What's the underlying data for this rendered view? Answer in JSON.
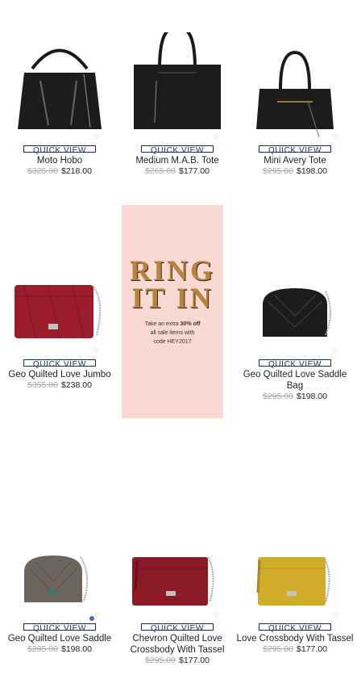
{
  "quick_view_label": "QUICK VIEW",
  "heart_icon": "heart-outline",
  "products": [
    {
      "name": "Moto Hobo",
      "old_price": "$325.00",
      "price": "$218.00"
    },
    {
      "name": "Medium M.A.B. Tote",
      "old_price": "$265.00",
      "price": "$177.00"
    },
    {
      "name": "Mini Avery Tote",
      "old_price": "$295.00",
      "price": "$198.00"
    },
    {
      "name": "Geo Quilted Love Jumbo",
      "old_price": "$355.00",
      "price": "$238.00"
    },
    {
      "name": "Geo Quilted Love Saddle Bag",
      "old_price": "$295.00",
      "price": "$198.00"
    },
    {
      "name": "Geo Quilted Love Saddle",
      "old_price": "$295.00",
      "price": "$198.00"
    },
    {
      "name": "Chevron Quilted Love Crossbody With Tassel",
      "old_price": "$295.00",
      "price": "$177.00"
    },
    {
      "name": "Love Crossbody With Tassel",
      "old_price": "$295.00",
      "price": "$177.00"
    }
  ],
  "promo": {
    "headline_1": "RING",
    "headline_2": "IT IN",
    "line_1_pre": "Take an extra ",
    "line_1_bold": "30% off",
    "line_2": "all sale items with",
    "line_3": "code HEY2017"
  },
  "colors": {
    "quick_view_border": "#1d2a57",
    "promo_bg": "#fbd9d3",
    "strike_price": "#a7a7a7",
    "gold": "#b7843f"
  }
}
